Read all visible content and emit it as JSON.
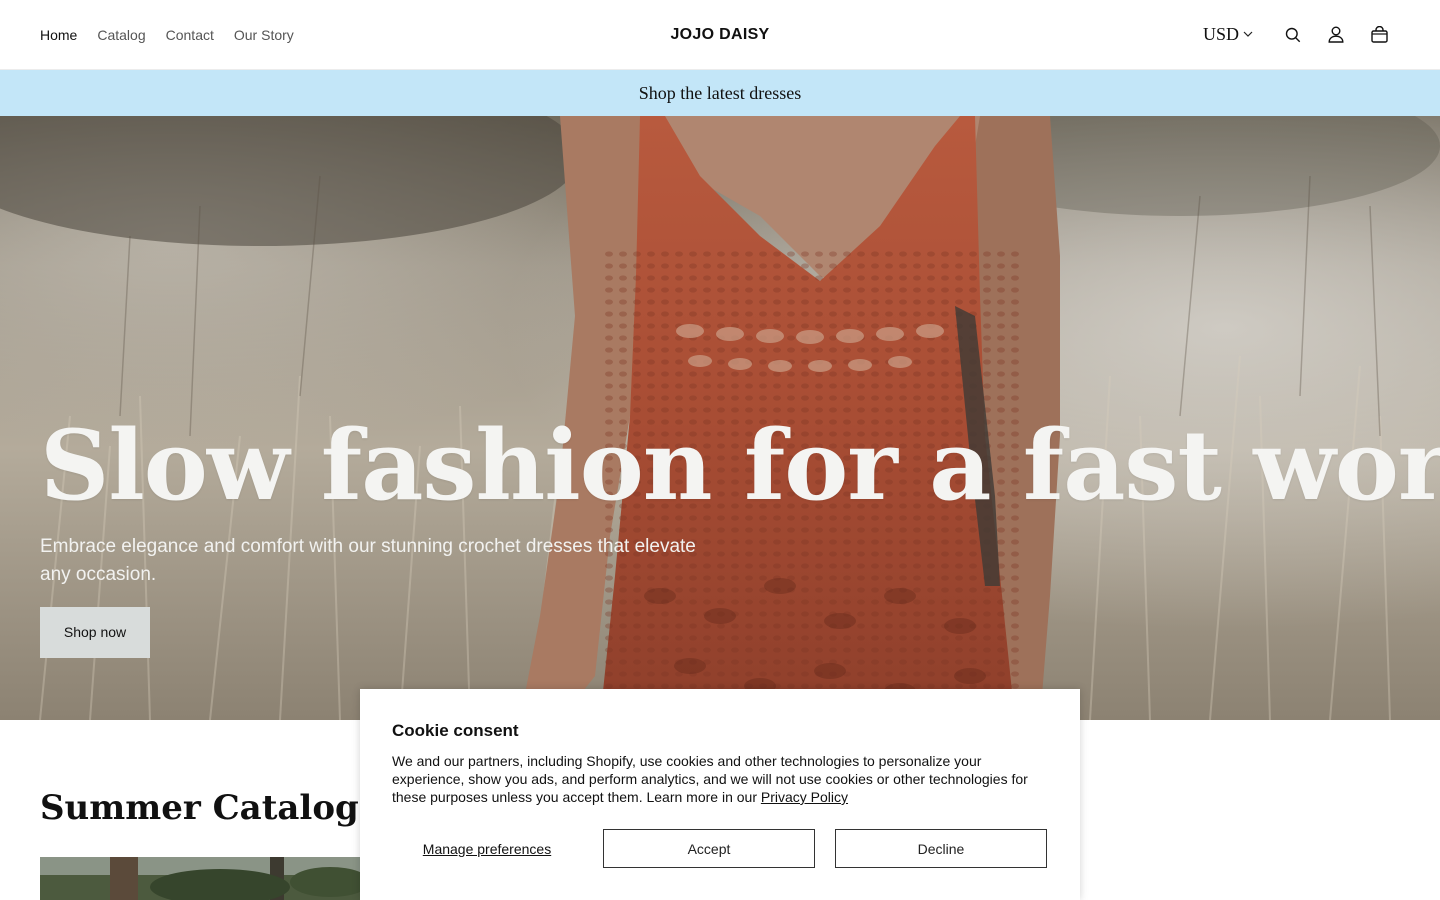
{
  "header": {
    "nav": [
      {
        "label": "Home"
      },
      {
        "label": "Catalog"
      },
      {
        "label": "Contact"
      },
      {
        "label": "Our Story"
      }
    ],
    "brand": "JOJO DAISY",
    "currency": "USD",
    "icons": [
      "chevron-down-icon",
      "search-icon",
      "account-icon",
      "cart-icon"
    ]
  },
  "announcement": "Shop the latest dresses",
  "hero": {
    "title": "Slow fashion for a fast world",
    "subtitle": "Embrace elegance and comfort with our stunning crochet dresses that elevate any occasion.",
    "cta": "Shop now"
  },
  "catalog": {
    "title": "Summer Catalog"
  },
  "cookie": {
    "title": "Cookie consent",
    "text": "We and our partners, including Shopify, use cookies and other technologies to personalize your experience, show you ads, and perform analytics, and we will not use cookies or other technologies for these purposes unless you accept them. Learn more in our ",
    "link": "Privacy Policy",
    "manage": "Manage preferences",
    "accept": "Accept",
    "decline": "Decline"
  },
  "colors": {
    "announcement_bg": "#c3e6f8",
    "dress": "#b4553c",
    "button_bg": "#d8dcdb"
  }
}
